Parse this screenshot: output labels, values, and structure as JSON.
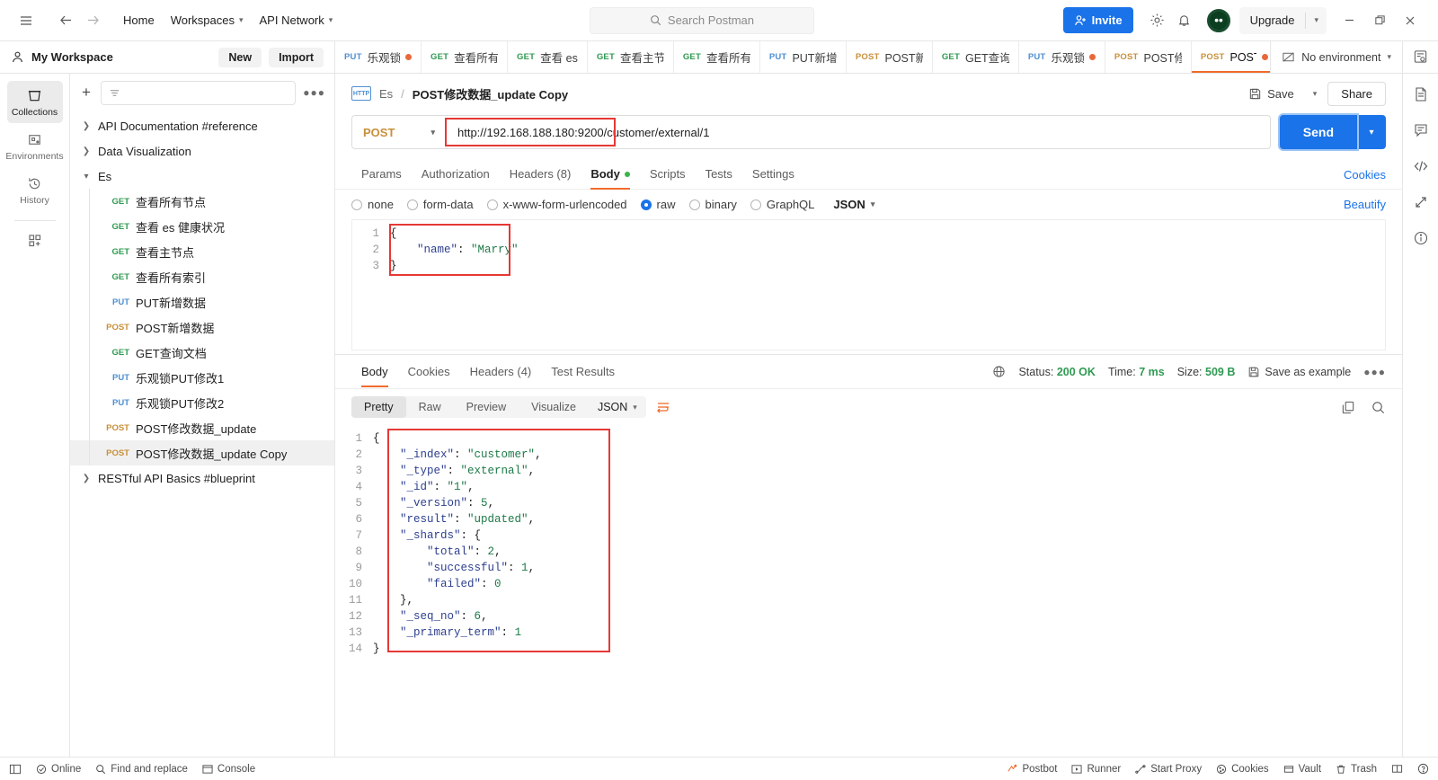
{
  "topbar": {
    "hamburger_icon": "hamburger-icon",
    "back_icon": "arrow-left-icon",
    "forward_icon": "arrow-right-icon",
    "home": "Home",
    "workspaces": "Workspaces",
    "api_network": "API Network",
    "search_placeholder": "Search Postman",
    "invite": "Invite",
    "settings_icon": "gear-icon",
    "notifications_icon": "bell-icon",
    "avatar_icon": "avatar-icon",
    "upgrade": "Upgrade",
    "minimize": "–",
    "maximize": "❐",
    "close": "✕"
  },
  "workspace": {
    "name": "My Workspace",
    "new_button": "New",
    "import_button": "Import"
  },
  "tabs": [
    {
      "method": "PUT",
      "label": "乐观锁",
      "dirty": true,
      "active": false
    },
    {
      "method": "GET",
      "label": "查看所有",
      "dirty": false,
      "active": false
    },
    {
      "method": "GET",
      "label": "查看 es",
      "dirty": false,
      "active": false
    },
    {
      "method": "GET",
      "label": "查看主节",
      "dirty": false,
      "active": false
    },
    {
      "method": "GET",
      "label": "查看所有",
      "dirty": false,
      "active": false
    },
    {
      "method": "PUT",
      "label": "PUT新增",
      "dirty": false,
      "active": false
    },
    {
      "method": "POST",
      "label": "POST新",
      "dirty": false,
      "active": false
    },
    {
      "method": "GET",
      "label": "GET查询",
      "dirty": false,
      "active": false
    },
    {
      "method": "PUT",
      "label": "乐观锁",
      "dirty": true,
      "active": false
    },
    {
      "method": "POST",
      "label": "POST修",
      "dirty": false,
      "active": false
    },
    {
      "method": "POST",
      "label": "POST",
      "dirty": true,
      "active": true
    }
  ],
  "environment": {
    "label": "No environment",
    "icon": "environment-icon"
  },
  "rail": [
    {
      "label": "Collections",
      "icon": "collections-icon",
      "active": true
    },
    {
      "label": "Environments",
      "icon": "environments-icon",
      "active": false
    },
    {
      "label": "History",
      "icon": "history-icon",
      "active": false
    }
  ],
  "rail_add_icon": "apps-add-icon",
  "sidebar": {
    "add_icon": "plus-icon",
    "filter_icon": "filter-icon",
    "more_icon": "more-icon",
    "tree": [
      {
        "type": "folder",
        "label": "API Documentation #reference",
        "expanded": false
      },
      {
        "type": "folder",
        "label": "Data Visualization",
        "expanded": false
      },
      {
        "type": "folder",
        "label": "Es",
        "expanded": true
      },
      {
        "type": "request",
        "method": "GET",
        "label": "查看所有节点",
        "selected": false
      },
      {
        "type": "request",
        "method": "GET",
        "label": "查看 es 健康状况",
        "selected": false
      },
      {
        "type": "request",
        "method": "GET",
        "label": "查看主节点",
        "selected": false
      },
      {
        "type": "request",
        "method": "GET",
        "label": "查看所有索引",
        "selected": false
      },
      {
        "type": "request",
        "method": "PUT",
        "label": "PUT新增数据",
        "selected": false
      },
      {
        "type": "request",
        "method": "POST",
        "label": "POST新增数据",
        "selected": false
      },
      {
        "type": "request",
        "method": "GET",
        "label": "GET查询文档",
        "selected": false
      },
      {
        "type": "request",
        "method": "PUT",
        "label": "乐观锁PUT修改1",
        "selected": false
      },
      {
        "type": "request",
        "method": "PUT",
        "label": "乐观锁PUT修改2",
        "selected": false
      },
      {
        "type": "request",
        "method": "POST",
        "label": "POST修改数据_update",
        "selected": false
      },
      {
        "type": "request",
        "method": "POST",
        "label": "POST修改数据_update Copy",
        "selected": true
      },
      {
        "type": "folder",
        "label": "RESTful API Basics #blueprint",
        "expanded": false
      }
    ]
  },
  "request": {
    "protocol_badge": "HTTP",
    "breadcrumb_collection": "Es",
    "breadcrumb_sep": "/",
    "name": "POST修改数据_update Copy",
    "save_label": "Save",
    "save_icon": "save-icon",
    "share_label": "Share",
    "method": "POST",
    "url": "http://192.168.188.180:9200/customer/external/1",
    "send_label": "Send",
    "tabs": [
      {
        "label": "Params",
        "active": false,
        "dot": false
      },
      {
        "label": "Authorization",
        "active": false,
        "dot": false
      },
      {
        "label": "Headers (8)",
        "active": false,
        "dot": false
      },
      {
        "label": "Body",
        "active": true,
        "dot": true
      },
      {
        "label": "Scripts",
        "active": false,
        "dot": false
      },
      {
        "label": "Tests",
        "active": false,
        "dot": false
      },
      {
        "label": "Settings",
        "active": false,
        "dot": false
      }
    ],
    "cookies_link": "Cookies",
    "body_modes": [
      {
        "label": "none",
        "selected": false
      },
      {
        "label": "form-data",
        "selected": false
      },
      {
        "label": "x-www-form-urlencoded",
        "selected": false
      },
      {
        "label": "raw",
        "selected": true
      },
      {
        "label": "binary",
        "selected": false
      },
      {
        "label": "GraphQL",
        "selected": false
      }
    ],
    "body_format": "JSON",
    "beautify": "Beautify",
    "body_lines": [
      {
        "n": "1",
        "text": "{"
      },
      {
        "n": "2",
        "text": "    \"name\": \"Marry\""
      },
      {
        "n": "3",
        "text": "}"
      }
    ]
  },
  "response": {
    "tabs": [
      {
        "label": "Body",
        "active": true
      },
      {
        "label": "Cookies",
        "active": false
      },
      {
        "label": "Headers (4)",
        "active": false
      },
      {
        "label": "Test Results",
        "active": false
      }
    ],
    "globe_icon": "globe-icon",
    "status_label": "Status:",
    "status_value": "200 OK",
    "time_label": "Time:",
    "time_value": "7 ms",
    "size_label": "Size:",
    "size_value": "509 B",
    "save_example": "Save as example",
    "save_example_icon": "save-icon",
    "more_icon": "more-icon",
    "view_modes": [
      {
        "label": "Pretty",
        "active": true
      },
      {
        "label": "Raw",
        "active": false
      },
      {
        "label": "Preview",
        "active": false
      },
      {
        "label": "Visualize",
        "active": false
      }
    ],
    "format": "JSON",
    "wrap_icon": "wrap-lines-icon",
    "copy_icon": "copy-icon",
    "search_icon": "search-icon",
    "body_lines": [
      {
        "n": "1",
        "text": "{"
      },
      {
        "n": "2",
        "text": "    \"_index\": \"customer\","
      },
      {
        "n": "3",
        "text": "    \"_type\": \"external\","
      },
      {
        "n": "4",
        "text": "    \"_id\": \"1\","
      },
      {
        "n": "5",
        "text": "    \"_version\": 5,"
      },
      {
        "n": "6",
        "text": "    \"result\": \"updated\","
      },
      {
        "n": "7",
        "text": "    \"_shards\": {"
      },
      {
        "n": "8",
        "text": "        \"total\": 2,"
      },
      {
        "n": "9",
        "text": "        \"successful\": 1,"
      },
      {
        "n": "10",
        "text": "        \"failed\": 0"
      },
      {
        "n": "11",
        "text": "    },"
      },
      {
        "n": "12",
        "text": "    \"_seq_no\": 6,"
      },
      {
        "n": "13",
        "text": "    \"_primary_term\": 1"
      },
      {
        "n": "14",
        "text": "}"
      }
    ]
  },
  "right_rail": [
    "documentation-icon",
    "comment-icon",
    "code-icon",
    "sync-icon",
    "info-icon"
  ],
  "statusbar": {
    "panel_icon": "layout-icon",
    "online": "Online",
    "find_replace": "Find and replace",
    "console": "Console",
    "postbot": "Postbot",
    "runner": "Runner",
    "start_proxy": "Start Proxy",
    "cookies": "Cookies",
    "vault": "Vault",
    "trash": "Trash",
    "layout_icon": "two-pane-icon",
    "help_icon": "help-icon"
  },
  "colors": {
    "accent": "#ef6c2d",
    "primary": "#1a73e8",
    "get": "#2f9a52",
    "post": "#c8903a",
    "put": "#4e8fd1",
    "highlight_box": "#e53935"
  }
}
